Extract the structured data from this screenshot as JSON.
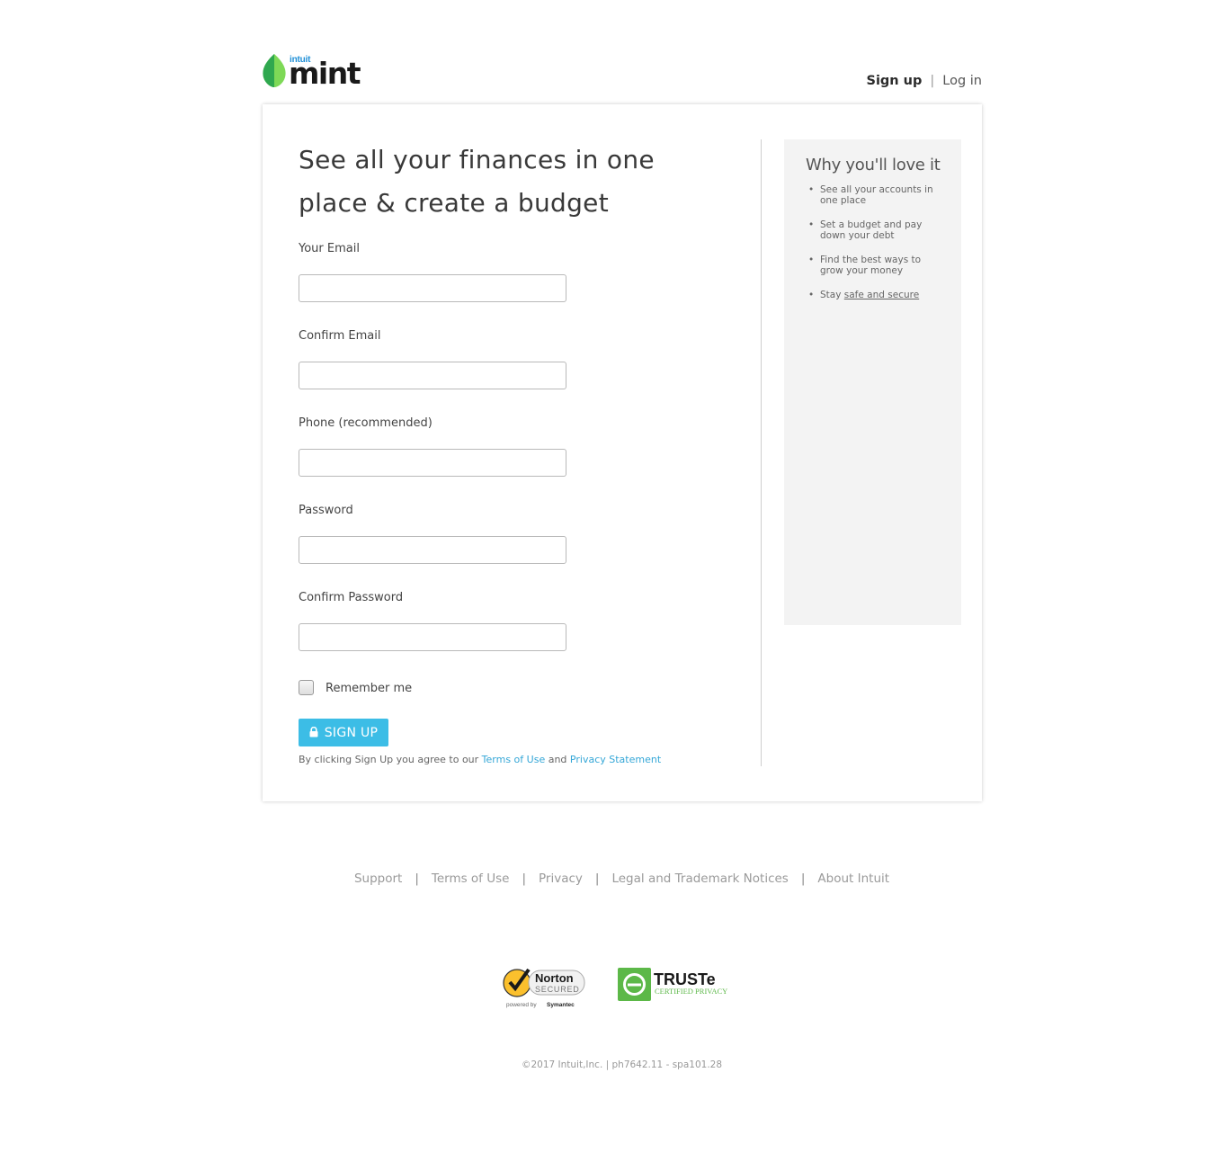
{
  "brand": {
    "intuit": "intuit",
    "name": "mint",
    "accent": "#3cbde6",
    "leaf_dark": "#2fa84f",
    "leaf_light": "#7ed957"
  },
  "top_nav": {
    "signup": "Sign up",
    "separator": "|",
    "login": "Log in"
  },
  "form": {
    "title": "See all your finances in one place & create a budget",
    "fields": [
      {
        "label": "Your Email",
        "value": "",
        "placeholder": ""
      },
      {
        "label": "Confirm Email",
        "value": "",
        "placeholder": ""
      },
      {
        "label": "Phone (recommended)",
        "value": "",
        "placeholder": ""
      },
      {
        "label": "Password",
        "value": "",
        "placeholder": ""
      },
      {
        "label": "Confirm Password",
        "value": "",
        "placeholder": ""
      }
    ],
    "remember_me": "Remember me",
    "remember_checked": false,
    "signup_button": "SIGN UP",
    "terms_prefix": "By clicking Sign Up you agree to our",
    "terms_link": "Terms of Use",
    "terms_and": "and",
    "privacy_link": "Privacy Statement"
  },
  "sidebar": {
    "title": "Why you'll love it",
    "items": [
      {
        "text": "See all your accounts in one place"
      },
      {
        "text": "Set a budget and pay down your debt"
      },
      {
        "text": "Find the best ways to grow your money"
      },
      {
        "prefix": "Stay",
        "link": "safe and secure"
      }
    ]
  },
  "footer": {
    "links": [
      "Support",
      "Terms of Use",
      "Privacy",
      "Legal and Trademark Notices",
      "About Intuit"
    ],
    "separator": "|",
    "copyright": "©2017 Intuit,Inc. | ph7642.11 - spa101.28"
  },
  "badges": {
    "norton": {
      "name": "Norton",
      "secured": "SECURED",
      "powered_by": "powered by",
      "symantec": "Symantec"
    },
    "truste": {
      "name": "TRUSTe",
      "sub": "CERTIFIED PRIVACY"
    }
  }
}
